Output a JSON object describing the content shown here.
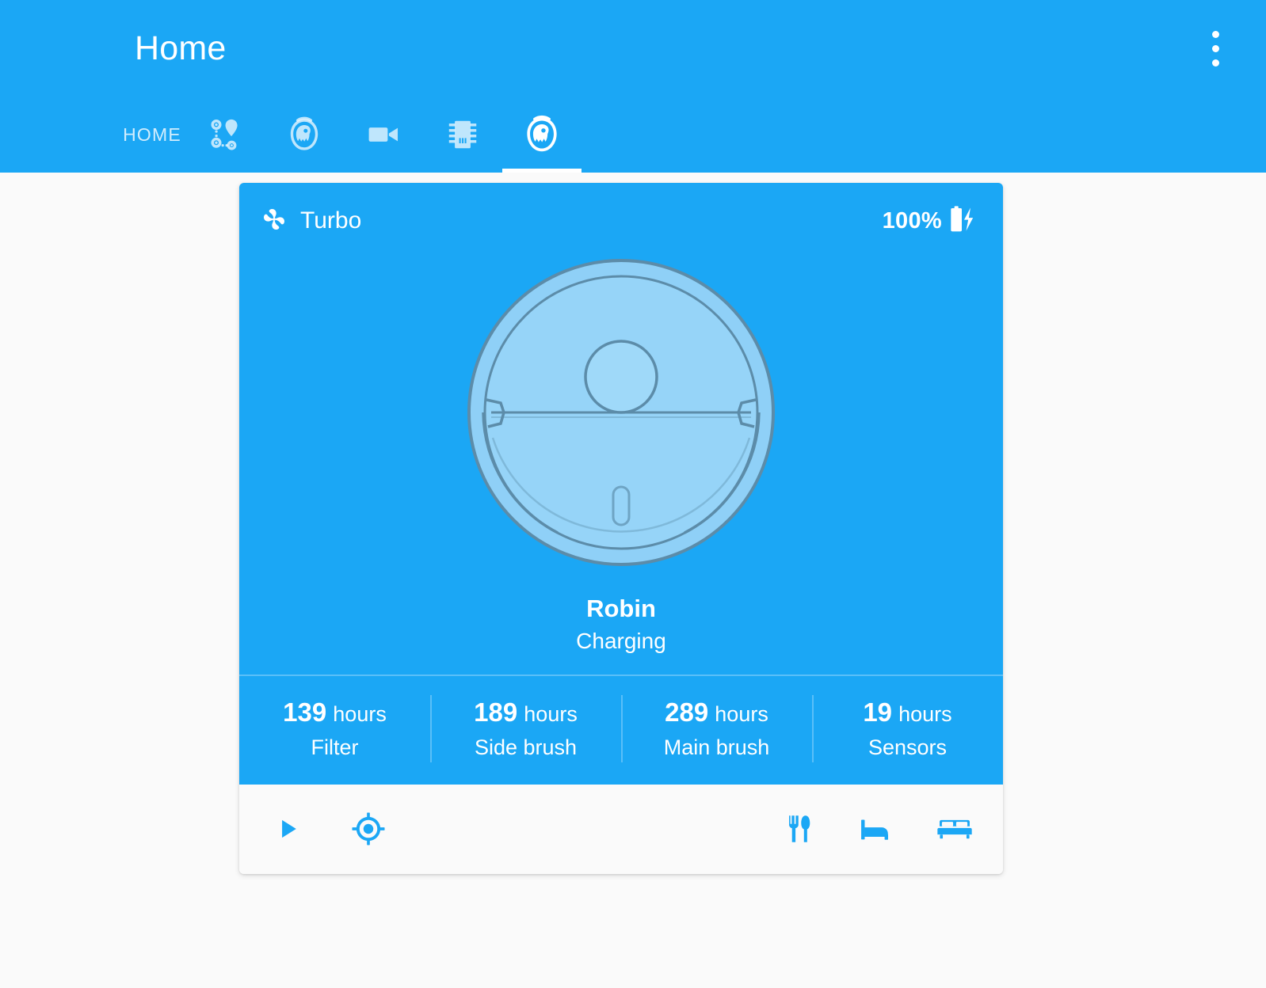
{
  "appbar": {
    "title": "Home",
    "overflow_menu_name": "more-options"
  },
  "tabs": [
    {
      "label": "HOME",
      "icon": "home-text",
      "active": false
    },
    {
      "label": "",
      "icon": "map-route-icon",
      "active": false
    },
    {
      "label": "",
      "icon": "vacuum-icon",
      "active": false
    },
    {
      "label": "",
      "icon": "camera-icon",
      "active": false
    },
    {
      "label": "",
      "icon": "chip-icon",
      "active": false
    },
    {
      "label": "",
      "icon": "vacuum-icon",
      "active": true
    }
  ],
  "card": {
    "fan_speed": "Turbo",
    "fan_icon": "fan-icon",
    "battery_percent": "100%",
    "battery_icon": "battery-charging-icon",
    "robot_name": "Robin",
    "robot_status": "Charging",
    "stats": [
      {
        "value": "139",
        "unit": "hours",
        "label": "Filter"
      },
      {
        "value": "189",
        "unit": "hours",
        "label": "Side brush"
      },
      {
        "value": "289",
        "unit": "hours",
        "label": "Main brush"
      },
      {
        "value": "19",
        "unit": "hours",
        "label": "Sensors"
      }
    ],
    "actions_left": [
      {
        "icon": "play-icon",
        "name": "start-cleaning-button"
      },
      {
        "icon": "locate-icon",
        "name": "locate-robot-button"
      }
    ],
    "actions_right": [
      {
        "icon": "cutlery-icon",
        "name": "clean-kitchen-button"
      },
      {
        "icon": "bed-icon",
        "name": "clean-bedroom-button"
      },
      {
        "icon": "sofa-icon",
        "name": "clean-living-room-button"
      }
    ]
  },
  "colors": {
    "accent": "#1ba7f5",
    "page_bg": "#fafafa",
    "robot_fill": "#8fd0f7",
    "robot_stroke": "#5e8fae",
    "on_accent": "#ffffff"
  }
}
